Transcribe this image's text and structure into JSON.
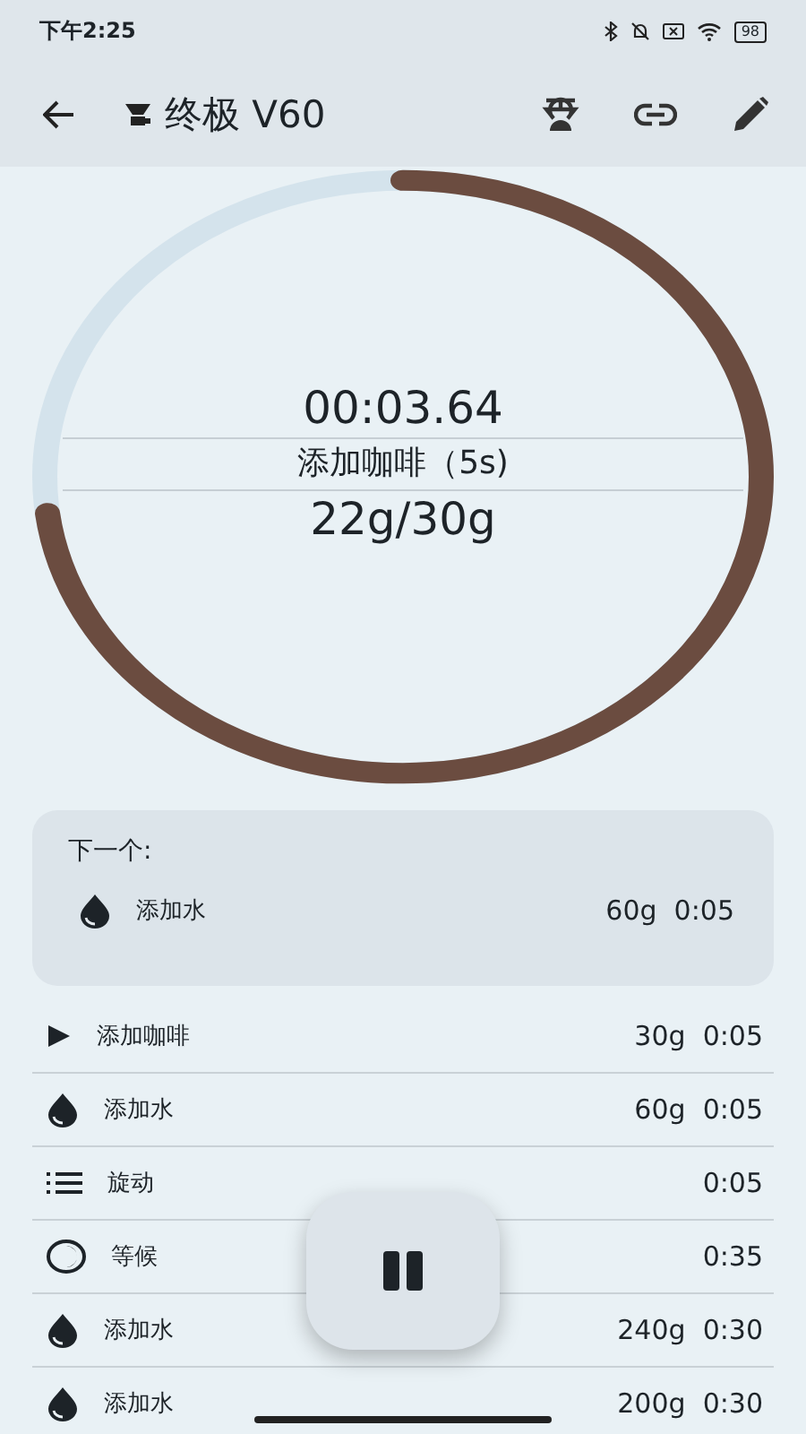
{
  "status_bar": {
    "time": "下午2:25",
    "battery": "98"
  },
  "app_bar": {
    "title": "终极 V60"
  },
  "timer": {
    "level": 0.73,
    "elapsed": "00:03.64",
    "step": "添加咖啡（5s)",
    "weight": "22g/30g"
  },
  "next": {
    "label": "下一个:",
    "step": {
      "kind": "water",
      "name": "添加水",
      "amount": "60g",
      "time": "0:05"
    }
  },
  "steps": [
    {
      "active": true,
      "name": "添加咖啡",
      "amount": "30g",
      "time": "0:05"
    },
    {
      "kind": "water",
      "active": false,
      "name": "添加水",
      "amount": "60g",
      "time": "0:05"
    },
    {
      "kind": "swirl",
      "active": false,
      "name": "旋动",
      "time": "0:05"
    },
    {
      "kind": "wait",
      "active": false,
      "name": "等候",
      "time": "0:35"
    },
    {
      "kind": "water",
      "active": false,
      "name": "添加水",
      "amount": "240g",
      "time": "0:30"
    },
    {
      "kind": "water",
      "active": false,
      "name": "添加水",
      "amount": "200g",
      "time": "0:30"
    }
  ],
  "pause_button": {
    "paused": false
  }
}
